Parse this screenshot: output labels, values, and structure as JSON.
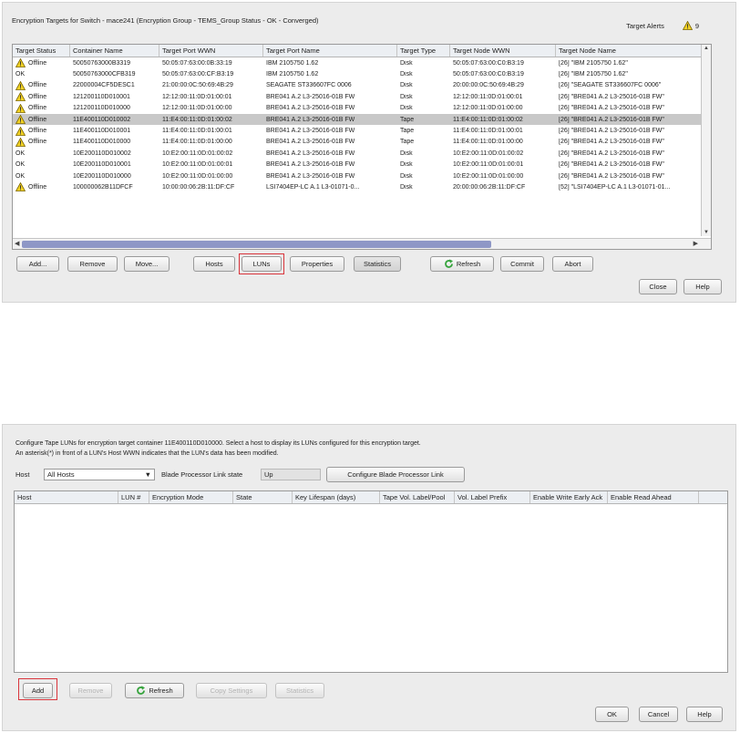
{
  "targets_dialog": {
    "title": "Encryption Targets for Switch - mace241 (Encryption Group - TEMS_Group Status - OK - Converged)",
    "target_alerts_label": "Target Alerts",
    "target_alerts_count": "9",
    "columns": [
      "Target Status",
      "Container Name",
      "Target Port WWN",
      "Target Port Name",
      "Target Type",
      "Target Node WWN",
      "Target Node Name"
    ],
    "rows": [
      {
        "status": "Offline",
        "warn": true,
        "container": "50050763000B3319",
        "port_wwn": "50:05:07:63:00:0B:33:19",
        "port_name": "IBM      2105750          1.62",
        "type": "Disk",
        "node_wwn": "50:05:07:63:00:C0:B3:19",
        "node_name": "[26] \"IBM      2105750          1.62\""
      },
      {
        "status": "OK",
        "warn": false,
        "container": "50050763000CFB319",
        "port_wwn": "50:05:07:63:00:CF:B3:19",
        "port_name": "IBM      2105750          1.62",
        "type": "Disk",
        "node_wwn": "50:05:07:63:00:C0:B3:19",
        "node_name": "[26] \"IBM      2105750          1.62\""
      },
      {
        "status": "Offline",
        "warn": true,
        "container": "22000004CF5DESC1",
        "port_wwn": "21:00:00:0C:50:69:4B:29",
        "port_name": "SEAGATE ST336607FC        0006",
        "type": "Disk",
        "node_wwn": "20:00:00:0C:50:69:4B:29",
        "node_name": "[26] \"SEAGATE ST336607FC         0006\""
      },
      {
        "status": "Offline",
        "warn": true,
        "container": "121200110D010001",
        "port_wwn": "12:12:00:11:0D:01:00:01",
        "port_name": "BRE041 A.2 L3-25016-01B FW",
        "type": "Disk",
        "node_wwn": "12:12:00:11:0D:01:00:01",
        "node_name": "[26] \"BRE041 A.2 L3-25016-01B FW\""
      },
      {
        "status": "Offline",
        "warn": true,
        "container": "121200110D010000",
        "port_wwn": "12:12:00:11:0D:01:00:00",
        "port_name": "BRE041 A.2 L3-25016-01B FW",
        "type": "Disk",
        "node_wwn": "12:12:00:11:0D:01:00:00",
        "node_name": "[26] \"BRE041 A.2 L3-25016-01B FW\""
      },
      {
        "status": "Offline",
        "warn": true,
        "selected": true,
        "container": "11E400110D010002",
        "port_wwn": "11:E4:00:11:0D:01:00:02",
        "port_name": "BRE041 A.2 L3-25016-01B FW",
        "type": "Tape",
        "node_wwn": "11:E4:00:11:0D:01:00:02",
        "node_name": "[26] \"BRE041 A.2 L3-25016-01B FW\""
      },
      {
        "status": "Offline",
        "warn": true,
        "container": "11E400110D010001",
        "port_wwn": "11:E4:00:11:0D:01:00:01",
        "port_name": "BRE041 A.2 L3-25016-01B FW",
        "type": "Tape",
        "node_wwn": "11:E4:00:11:0D:01:00:01",
        "node_name": "[26] \"BRE041 A.2 L3-25016-01B FW\""
      },
      {
        "status": "Offline",
        "warn": true,
        "container": "11E400110D010000",
        "port_wwn": "11:E4:00:11:0D:01:00:00",
        "port_name": "BRE041 A.2 L3-25016-01B FW",
        "type": "Tape",
        "node_wwn": "11:E4:00:11:0D:01:00:00",
        "node_name": "[26] \"BRE041 A.2 L3-25016-01B FW\""
      },
      {
        "status": "OK",
        "warn": false,
        "container": "10E200110D010002",
        "port_wwn": "10:E2:00:11:0D:01:00:02",
        "port_name": "BRE041 A.2 L3-25016-01B FW",
        "type": "Disk",
        "node_wwn": "10:E2:00:11:0D:01:00:02",
        "node_name": "[26] \"BRE041 A.2 L3-25016-01B FW\""
      },
      {
        "status": "OK",
        "warn": false,
        "container": "10E200110D010001",
        "port_wwn": "10:E2:00:11:0D:01:00:01",
        "port_name": "BRE041 A.2 L3-25016-01B FW",
        "type": "Disk",
        "node_wwn": "10:E2:00:11:0D:01:00:01",
        "node_name": "[26] \"BRE041 A.2 L3-25016-01B FW\""
      },
      {
        "status": "OK",
        "warn": false,
        "container": "10E200110D010000",
        "port_wwn": "10:E2:00:11:0D:01:00:00",
        "port_name": "BRE041 A.2 L3-25016-01B FW",
        "type": "Disk",
        "node_wwn": "10:E2:00:11:0D:01:00:00",
        "node_name": "[26] \"BRE041 A.2 L3-25016-01B FW\""
      },
      {
        "status": "Offline",
        "warn": true,
        "container": "100000062B11DFCF",
        "port_wwn": "10:00:00:06:2B:11:DF:CF",
        "port_name": "LSI7404EP-LC A.1 L3-01071-0...",
        "type": "Disk",
        "node_wwn": "20:00:00:06:2B:11:DF:CF",
        "node_name": "[52] \"LSI7404EP-LC A.1 L3-01071-01..."
      }
    ],
    "buttons": {
      "add": "Add...",
      "remove": "Remove",
      "move": "Move...",
      "hosts": "Hosts",
      "luns": "LUNs",
      "properties": "Properties",
      "statistics": "Statistics",
      "refresh": "Refresh",
      "commit": "Commit",
      "abort": "Abort",
      "close": "Close",
      "help": "Help"
    }
  },
  "luns_dialog": {
    "description_line1": "Configure Tape LUNs for encryption target container 11E400110D010000. Select a host to display its LUNs configured for this encryption target.",
    "description_line2": "An asterisk(*) in front of a LUN's Host WWN indicates that the LUN's data has been modified.",
    "host_label": "Host",
    "host_value": "All Hosts",
    "blade_state_label": "Blade Processor Link state",
    "blade_state_value": "Up",
    "configure_link_button": "Configure Blade Processor Link",
    "columns": [
      "Host",
      "LUN #",
      "Encryption Mode",
      "State",
      "Key Lifespan (days)",
      "Tape Vol. Label/Pool",
      "Vol. Label Prefix",
      "Enable Write Early Ack",
      "Enable Read Ahead"
    ],
    "buttons": {
      "add": "Add",
      "remove": "Remove",
      "refresh": "Refresh",
      "copy_settings": "Copy Settings",
      "statistics": "Statistics",
      "ok": "OK",
      "cancel": "Cancel",
      "help": "Help"
    }
  },
  "colors": {
    "highlight": "#d9343b",
    "warning": "#f2d224",
    "refresh_green": "#35a33c",
    "scroll_thumb": "#8e97c6",
    "selected_row": "#c8c8c8"
  }
}
